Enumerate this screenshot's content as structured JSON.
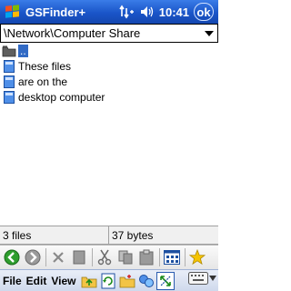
{
  "titlebar": {
    "app_title": "GSFinder+",
    "clock": "10:41",
    "ok_label": "ok",
    "icons": [
      "windows-start-icon",
      "connectivity-icon",
      "volume-icon"
    ]
  },
  "pathbar": {
    "path": "\\Network\\Computer Share"
  },
  "filelist": {
    "items": [
      {
        "name": "..",
        "icon": "folder-up-icon",
        "selected": true
      },
      {
        "name": "These files",
        "icon": "file-icon",
        "selected": false
      },
      {
        "name": "are on the",
        "icon": "file-icon",
        "selected": false
      },
      {
        "name": "desktop computer",
        "icon": "file-icon",
        "selected": false
      }
    ]
  },
  "statusbar": {
    "file_count": "3 files",
    "total_size": "37 bytes"
  },
  "toolbar": {
    "buttons": [
      "back-icon",
      "forward-icon",
      "delete-icon",
      "properties-icon",
      "cut-icon",
      "copy-icon",
      "paste-icon",
      "view-mode-icon",
      "favorites-icon"
    ]
  },
  "menubar": {
    "file": "File",
    "edit": "Edit",
    "view": "View",
    "buttons": [
      "folder-up-icon",
      "refresh-icon",
      "new-folder-icon",
      "sync-icon",
      "select-all-icon",
      "keyboard-icon"
    ]
  },
  "colors": {
    "titlebar": "#1a55c8",
    "selection": "#316ac5",
    "favorites_star": "#f5c400",
    "back_green": "#2e9e2e"
  }
}
